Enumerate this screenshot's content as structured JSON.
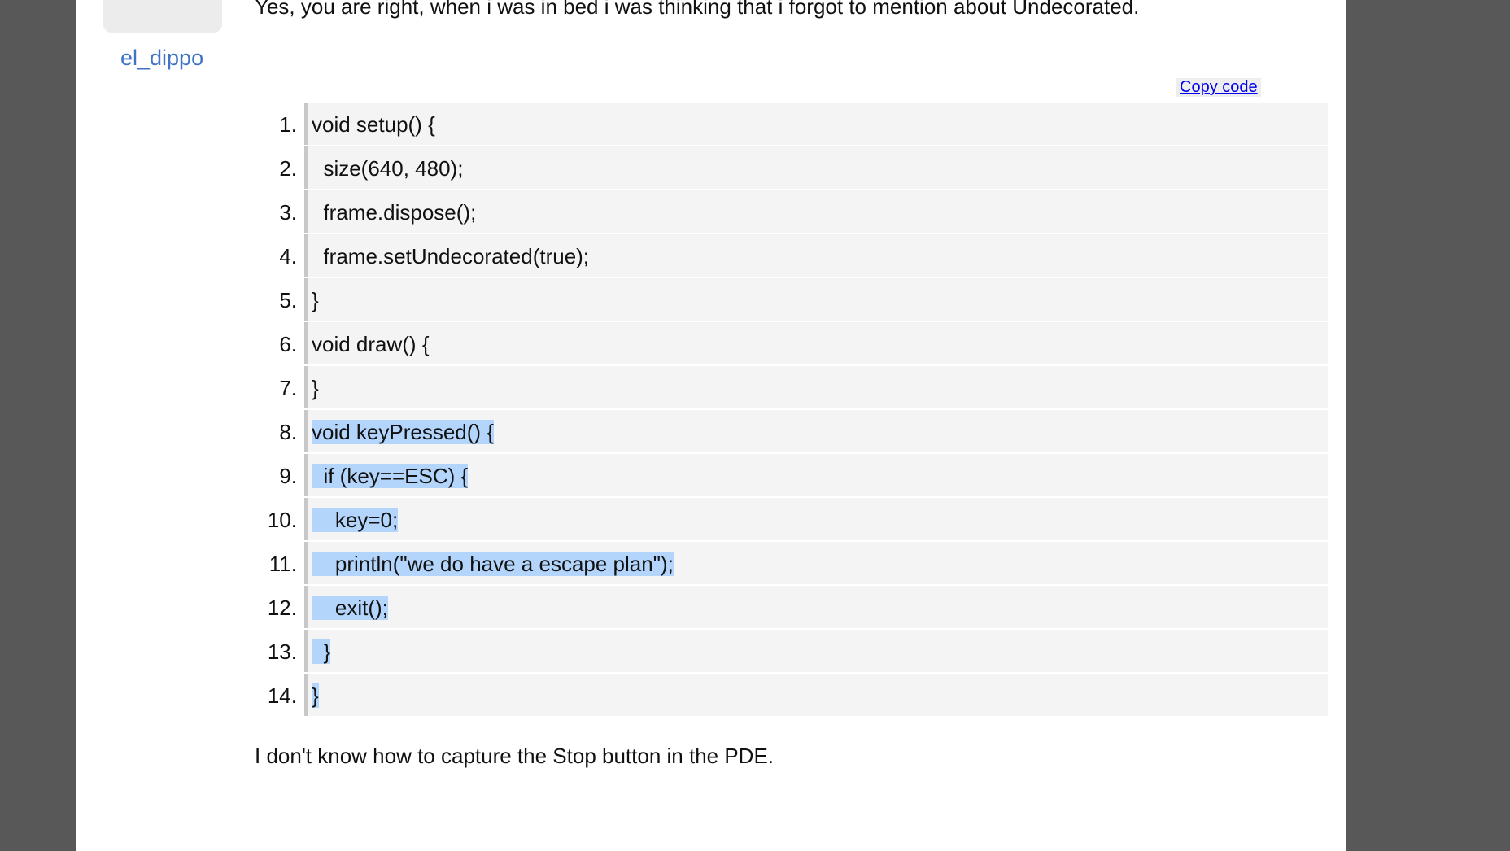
{
  "post": {
    "username": "el_dippo",
    "top_text": "Yes, you are right, when i was in bed i was thinking that i forgot to mention about Undecorated.",
    "copy_code_label": "Copy code",
    "bottom_text": "I don't know how to capture the Stop button in the PDE."
  },
  "code": {
    "lines": [
      {
        "num": "1.",
        "text": "void setup() {",
        "selected": false
      },
      {
        "num": "2.",
        "text": "  size(640, 480);",
        "selected": false
      },
      {
        "num": "3.",
        "text": "  frame.dispose();",
        "selected": false
      },
      {
        "num": "4.",
        "text": "  frame.setUndecorated(true);",
        "selected": false
      },
      {
        "num": "5.",
        "text": "}",
        "selected": false
      },
      {
        "num": "6.",
        "text": "void draw() {",
        "selected": false
      },
      {
        "num": "7.",
        "text": "}",
        "selected": false
      },
      {
        "num": "8.",
        "text": "void keyPressed() {",
        "selected": true
      },
      {
        "num": "9.",
        "text": "  if (key==ESC) {",
        "selected": true
      },
      {
        "num": "10.",
        "text": "    key=0;",
        "selected": true
      },
      {
        "num": "11.",
        "text": "    println(\"we do have a escape plan\");",
        "selected": true
      },
      {
        "num": "12.",
        "text": "    exit();",
        "selected": true
      },
      {
        "num": "13.",
        "text": "  }",
        "selected": true
      },
      {
        "num": "14.",
        "text": "}",
        "selected": true
      }
    ]
  }
}
